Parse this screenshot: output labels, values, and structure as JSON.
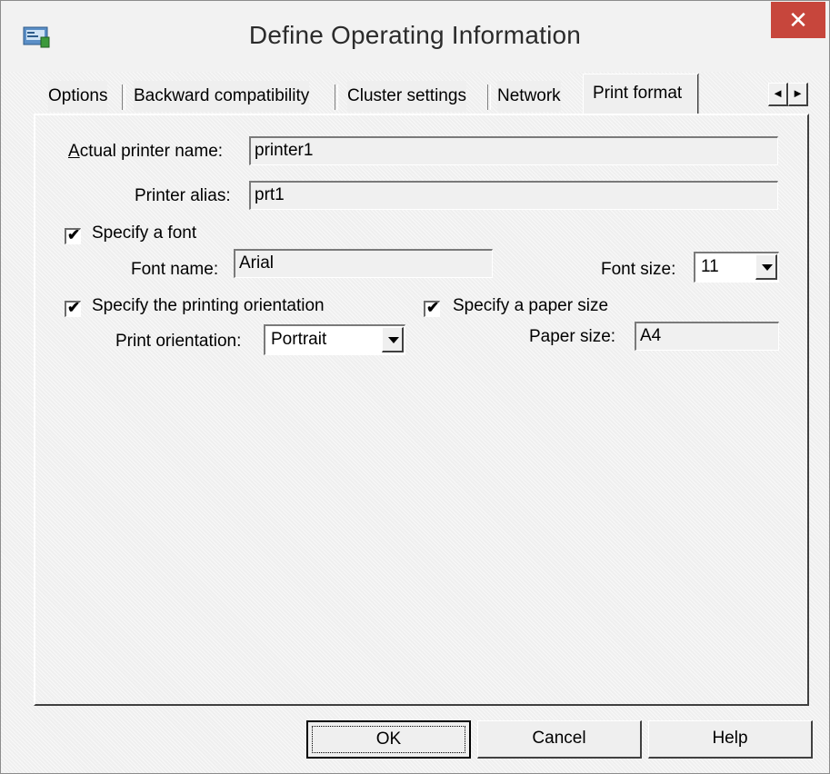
{
  "window": {
    "title": "Define Operating Information",
    "close_label": "✕"
  },
  "tabs": [
    {
      "label": "Options"
    },
    {
      "label": "Backward compatibility"
    },
    {
      "label": "Cluster settings"
    },
    {
      "label": "Network"
    },
    {
      "label": "Print format",
      "active": true
    }
  ],
  "tab_scroll": {
    "left": "◄",
    "right": "►"
  },
  "form": {
    "actual_printer_name": {
      "label": "Actual printer name:",
      "value": "printer1"
    },
    "printer_alias": {
      "label": "Printer alias:",
      "value": "prt1"
    },
    "specify_font": {
      "label": "Specify a font",
      "checked": true
    },
    "font_name": {
      "label": "Font name:",
      "value": "Arial"
    },
    "font_size": {
      "label": "Font size:",
      "value": "11"
    },
    "specify_orientation": {
      "label": "Specify the printing orientation",
      "checked": true
    },
    "print_orientation": {
      "label": "Print orientation:",
      "value": "Portrait"
    },
    "specify_paper_size": {
      "label": "Specify a paper size",
      "checked": true
    },
    "paper_size": {
      "label": "Paper size:",
      "value": "A4"
    }
  },
  "buttons": {
    "ok": "OK",
    "cancel": "Cancel",
    "help": "Help"
  },
  "colors": {
    "close_button": "#c7463c",
    "panel_background": "#efefef"
  }
}
